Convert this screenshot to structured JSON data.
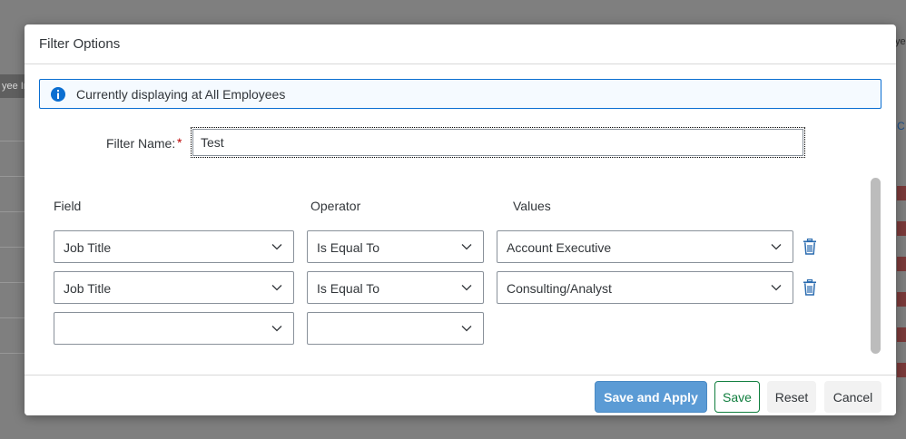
{
  "background": {
    "left_bar_text": "yee In",
    "right_text": "ye",
    "right_link": "C"
  },
  "dialog": {
    "title": "Filter Options",
    "info_message": "Currently displaying at All Employees",
    "filter_name": {
      "label": "Filter Name:",
      "required_mark": "*",
      "value": "Test"
    },
    "columns": {
      "field": "Field",
      "operator": "Operator",
      "values": "Values"
    },
    "rows": [
      {
        "field": "Job Title",
        "operator": "Is Equal To",
        "value": "Account Executive"
      },
      {
        "field": "Job Title",
        "operator": "Is Equal To",
        "value": "Consulting/Analyst"
      },
      {
        "field": "",
        "operator": ""
      }
    ],
    "footer": {
      "save_apply": "Save and Apply",
      "save": "Save",
      "reset": "Reset",
      "cancel": "Cancel"
    }
  },
  "icons": {
    "info": "info-circle-icon",
    "chevron": "chevron-down-icon",
    "delete": "trash-icon"
  },
  "colors": {
    "accent": "#0a6ed1",
    "primary_button": "#5b9bd5",
    "save_button": "#107e3e",
    "required": "#bb0000"
  }
}
